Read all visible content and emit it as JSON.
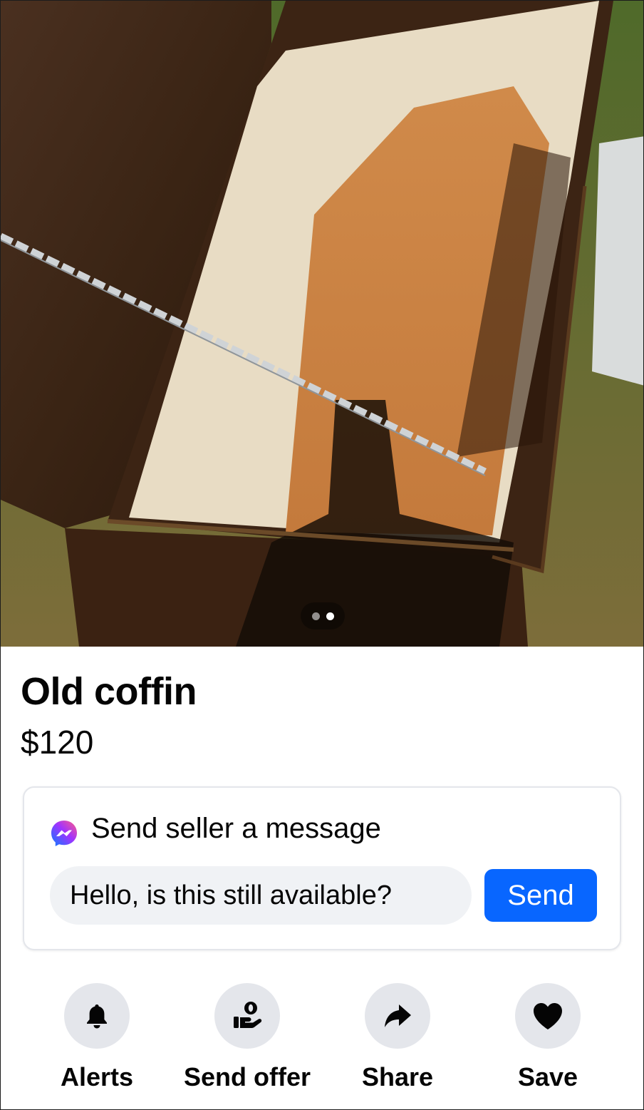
{
  "listing": {
    "title": "Old coffin",
    "price": "$120",
    "photo_pager": {
      "count": 2,
      "active_index": 1
    }
  },
  "message": {
    "header_label": "Send seller a message",
    "icon": "messenger-icon",
    "input_value": "Hello, is this still available?",
    "send_label": "Send"
  },
  "actions": [
    {
      "label": "Alerts",
      "icon": "bell-icon"
    },
    {
      "label": "Send offer",
      "icon": "offer-hand-icon"
    },
    {
      "label": "Share",
      "icon": "share-arrow-icon"
    },
    {
      "label": "Save",
      "icon": "heart-icon"
    }
  ],
  "colors": {
    "accent": "#0866ff",
    "icon_circle": "#e4e6eb",
    "input_bg": "#f0f2f5",
    "text": "#050505"
  }
}
